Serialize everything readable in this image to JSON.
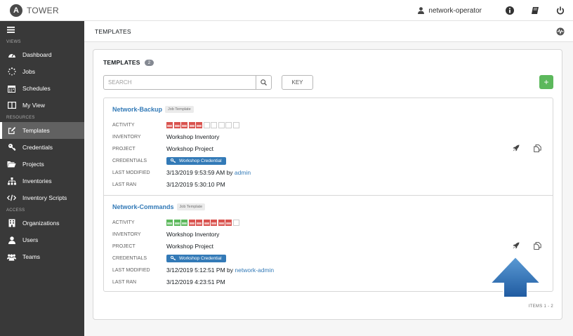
{
  "app": {
    "logo_letter": "A",
    "title": "TOWER"
  },
  "topbar": {
    "username": "network-operator",
    "icons": [
      "user-icon",
      "info-icon",
      "docs-book-icon",
      "power-icon"
    ]
  },
  "sidebar": {
    "sections": [
      {
        "label": "VIEWS",
        "items": [
          {
            "label": "Dashboard",
            "icon": "dashboard-icon"
          },
          {
            "label": "Jobs",
            "icon": "jobs-spinner-icon"
          },
          {
            "label": "Schedules",
            "icon": "calendar-icon"
          },
          {
            "label": "My View",
            "icon": "columns-icon"
          }
        ]
      },
      {
        "label": "RESOURCES",
        "items": [
          {
            "label": "Templates",
            "icon": "pencil-square-icon",
            "active": true
          },
          {
            "label": "Credentials",
            "icon": "key-icon"
          },
          {
            "label": "Projects",
            "icon": "folder-open-icon"
          },
          {
            "label": "Inventories",
            "icon": "sitemap-icon"
          },
          {
            "label": "Inventory Scripts",
            "icon": "code-icon"
          }
        ]
      },
      {
        "label": "ACCESS",
        "items": [
          {
            "label": "Organizations",
            "icon": "building-icon"
          },
          {
            "label": "Users",
            "icon": "user-icon"
          },
          {
            "label": "Teams",
            "icon": "users-icon"
          }
        ]
      }
    ]
  },
  "breadcrumb": {
    "current": "TEMPLATES"
  },
  "panel": {
    "title": "TEMPLATES",
    "count": "2",
    "search_placeholder": "SEARCH",
    "key_label": "KEY",
    "add_label": "+",
    "items_label": "ITEMS  1 - 2"
  },
  "labels": {
    "activity": "ACTIVITY",
    "inventory": "INVENTORY",
    "project": "PROJECT",
    "credentials": "CREDENTIALS",
    "last_modified": "LAST MODIFIED",
    "last_ran": "LAST RAN",
    "by": "by"
  },
  "templates": [
    {
      "name": "Network-Backup",
      "type": "Job Template",
      "activity": [
        "fail",
        "fail",
        "fail",
        "fail",
        "fail",
        "none",
        "none",
        "none",
        "none",
        "none"
      ],
      "inventory": "Workshop Inventory",
      "project": "Workshop Project",
      "credential": "Workshop Credential",
      "last_modified": "3/13/2019 9:53:59 AM",
      "modified_by": "admin",
      "last_ran": "3/12/2019 5:30:10 PM"
    },
    {
      "name": "Network-Commands",
      "type": "Job Template",
      "activity": [
        "ok",
        "ok",
        "ok",
        "fail",
        "fail",
        "fail",
        "fail",
        "fail",
        "fail",
        "none"
      ],
      "inventory": "Workshop Inventory",
      "project": "Workshop Project",
      "credential": "Workshop Credential",
      "last_modified": "3/12/2019 5:12:51 PM",
      "modified_by": "network-admin",
      "last_ran": "3/12/2019 4:23:51 PM"
    }
  ],
  "colors": {
    "sidebar_bg": "#393939",
    "link": "#337ab7",
    "success": "#5cb85c",
    "failed": "#d9534f",
    "annotation_arrow": "#2f6fb3"
  }
}
